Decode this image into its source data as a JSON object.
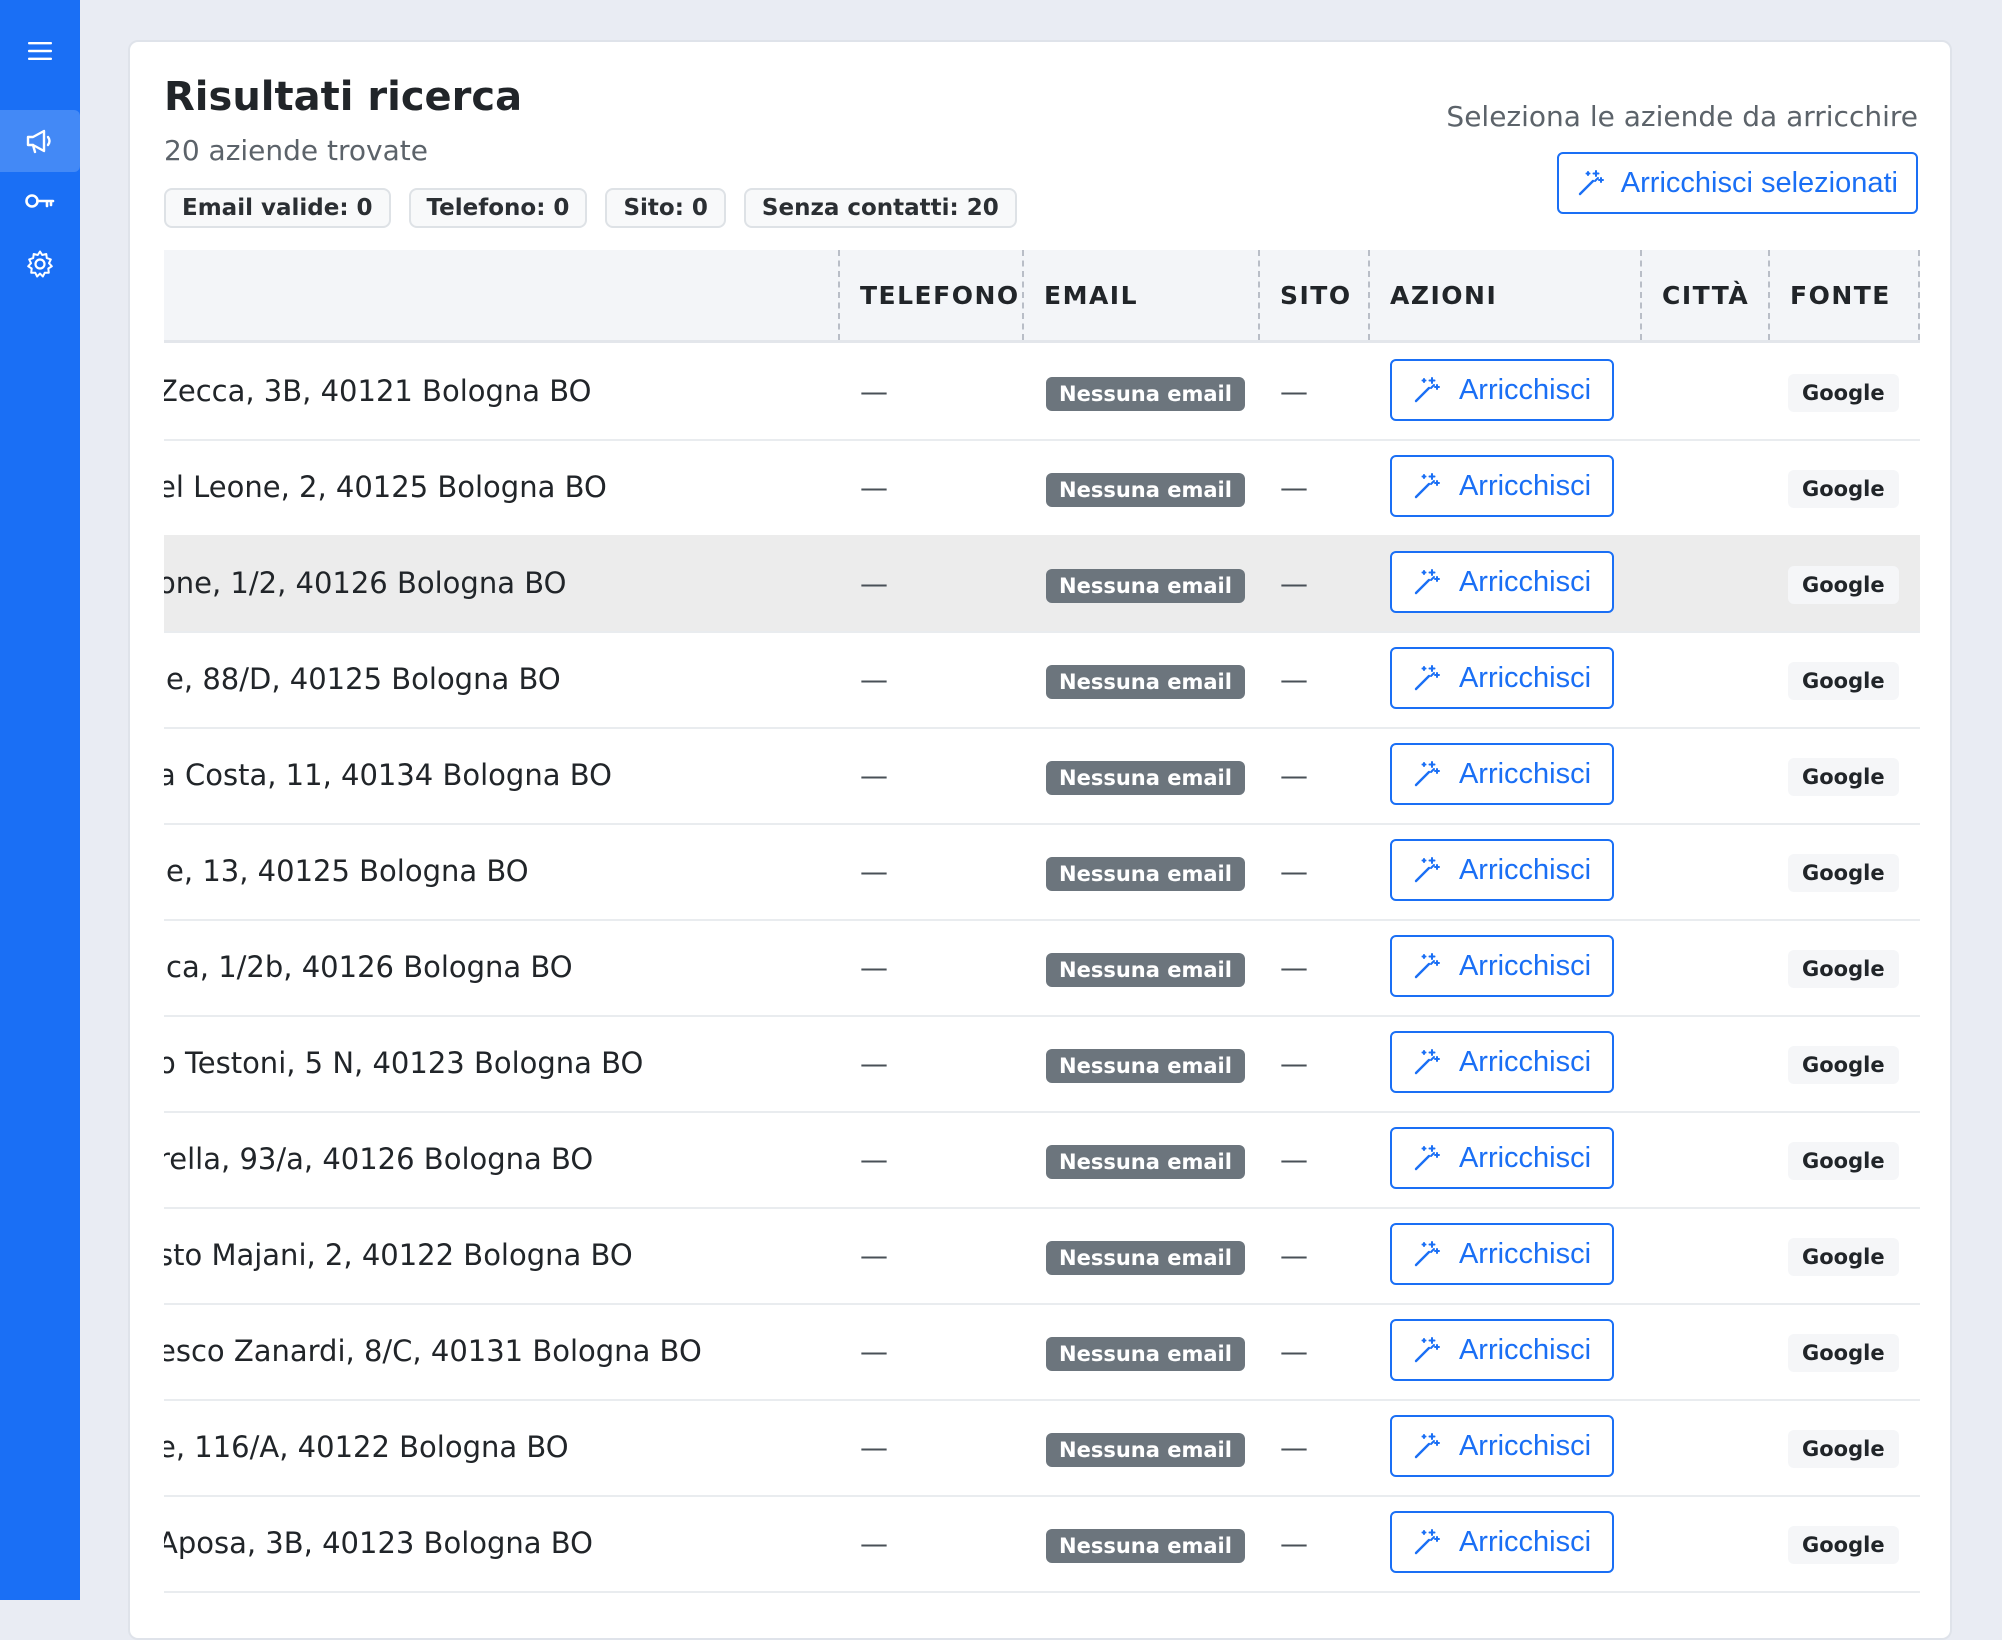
{
  "sidebar": {
    "menu_icon": "hamburger-menu-icon",
    "items": [
      {
        "icon": "megaphone-icon",
        "active": true
      },
      {
        "icon": "key-icon",
        "active": false
      },
      {
        "icon": "gear-icon",
        "active": false
      }
    ]
  },
  "header": {
    "title": "Risultati ricerca",
    "subtitle": "20 aziende trovate",
    "chips": [
      "Email valide: 0",
      "Telefono: 0",
      "Sito: 0",
      "Senza contatti: 20"
    ],
    "select_hint": "Seleziona le aziende da arricchire",
    "bulk_button": "Arricchisci selezionati",
    "bulk_button_icon": "magic-wand-icon"
  },
  "table": {
    "columns": {
      "phone": "TELEFONO",
      "email": "EMAIL",
      "site": "SITO",
      "actions": "AZIONI",
      "city": "CITTÀ",
      "source": "FONTE"
    },
    "rows": [
      {
        "address": "Zecca, 3B, 40121 Bologna BO",
        "phone": "—",
        "email": "Nessuna email",
        "site": "—",
        "action": "Arricchisci",
        "city": "",
        "source": "Google"
      },
      {
        "address": "el Leone, 2, 40125 Bologna BO",
        "phone": "—",
        "email": "Nessuna email",
        "site": "—",
        "action": "Arricchisci",
        "city": "",
        "source": "Google"
      },
      {
        "address": "one, 1/2, 40126 Bologna BO",
        "phone": "—",
        "email": "Nessuna email",
        "site": "—",
        "action": "Arricchisci",
        "city": "",
        "source": "Google"
      },
      {
        "address": "le, 88/D, 40125 Bologna BO",
        "phone": "—",
        "email": "Nessuna email",
        "site": "—",
        "action": "Arricchisci",
        "city": "",
        "source": "Google"
      },
      {
        "address": "a Costa, 11, 40134 Bologna BO",
        "phone": "—",
        "email": "Nessuna email",
        "site": "—",
        "action": "Arricchisci",
        "city": "",
        "source": "Google"
      },
      {
        "address": "le, 13, 40125 Bologna BO",
        "phone": "—",
        "email": "Nessuna email",
        "site": "—",
        "action": "Arricchisci",
        "city": "",
        "source": "Google"
      },
      {
        "address": "ica, 1/2b, 40126 Bologna BO",
        "phone": "—",
        "email": "Nessuna email",
        "site": "—",
        "action": "Arricchisci",
        "city": "",
        "source": "Google"
      },
      {
        "address": "o Testoni, 5 N, 40123 Bologna BO",
        "phone": "—",
        "email": "Nessuna email",
        "site": "—",
        "action": "Arricchisci",
        "city": "",
        "source": "Google"
      },
      {
        "address": "rella, 93/a, 40126 Bologna BO",
        "phone": "—",
        "email": "Nessuna email",
        "site": "—",
        "action": "Arricchisci",
        "city": "",
        "source": "Google"
      },
      {
        "address": "sto Majani, 2, 40122 Bologna BO",
        "phone": "—",
        "email": "Nessuna email",
        "site": "—",
        "action": "Arricchisci",
        "city": "",
        "source": "Google"
      },
      {
        "address": "esco Zanardi, 8/C, 40131 Bologna BO",
        "phone": "—",
        "email": "Nessuna email",
        "site": "—",
        "action": "Arricchisci",
        "city": "",
        "source": "Google"
      },
      {
        "address": "e, 116/A, 40122 Bologna BO",
        "phone": "—",
        "email": "Nessuna email",
        "site": "—",
        "action": "Arricchisci",
        "city": "",
        "source": "Google"
      },
      {
        "address": "Aposa, 3B, 40123 Bologna BO",
        "phone": "—",
        "email": "Nessuna email",
        "site": "—",
        "action": "Arricchisci",
        "city": "",
        "source": "Google"
      }
    ]
  },
  "colors": {
    "accent": "#1a6ff5",
    "badge": "#6c757d",
    "page_bg": "#e9ecf3"
  }
}
